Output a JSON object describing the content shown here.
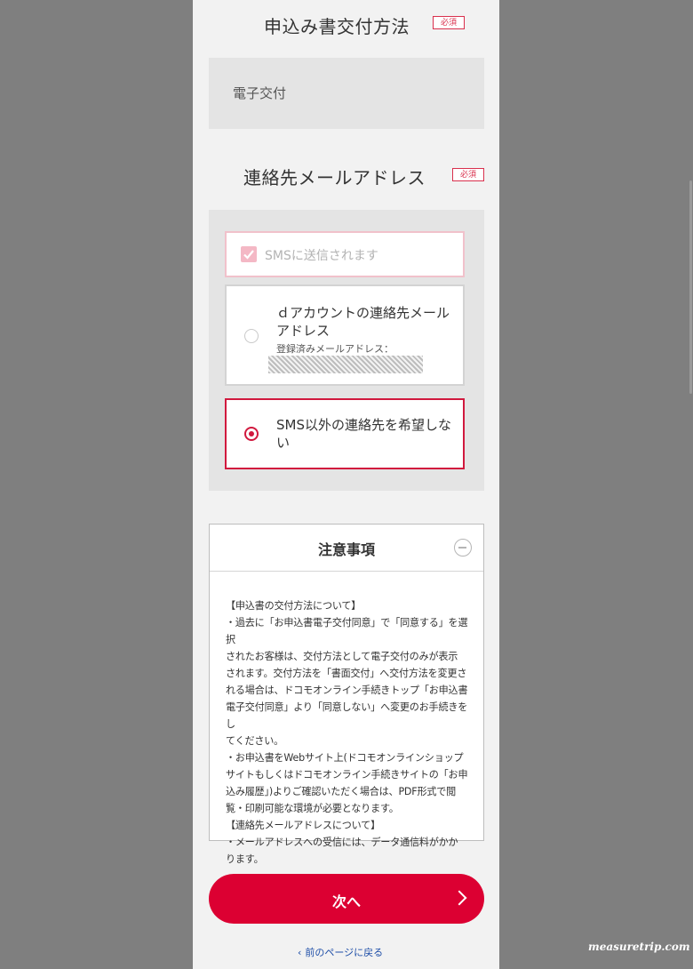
{
  "delivery": {
    "title": "申込み書交付方法",
    "required": "必須",
    "value": "電子交付"
  },
  "contact": {
    "title": "連絡先メールアドレス",
    "required": "必須",
    "sms_option": "SMSに送信されます",
    "dacct_option_line1": "ｄアカウントの連絡先メール",
    "dacct_option_line2": "アドレス",
    "dacct_registered": "登録済みメールアドレス：",
    "none_option_line1": "SMS以外の連絡先を希望しな",
    "none_option_line2": "い",
    "selected": "SMS以外の連絡先を希望しない"
  },
  "notes": {
    "title": "注意事項",
    "lines": [
      "【申込書の交付方法について】",
      "・過去に「お申込書電子交付同意」で「同意する」を選択",
      "されたお客様は、交付方法として電子交付のみが表示",
      "されます。交付方法を「書面交付」へ交付方法を変更さ",
      "れる場合は、ドコモオンライン手続きトップ「お申込書",
      "電子交付同意」より「同意しない」へ変更のお手続きをし",
      "てください。",
      "・お申込書をWebサイト上(ドコモオンラインショップ",
      "サイトもしくはドコモオンライン手続きサイトの「お申",
      "込み履歴」)よりご確認いただく場合は、PDF形式で閲",
      "覧・印刷可能な環境が必要となります。",
      "【連絡先メールアドレスについて】",
      "・メールアドレスへの受信には、データ通信料がかか",
      "ります。"
    ]
  },
  "next_button": "次へ",
  "back_link": "前のページに戻る",
  "watermark": "measuretrip.com",
  "colors": {
    "accent": "#dc0032",
    "link": "#1f4fa8"
  }
}
